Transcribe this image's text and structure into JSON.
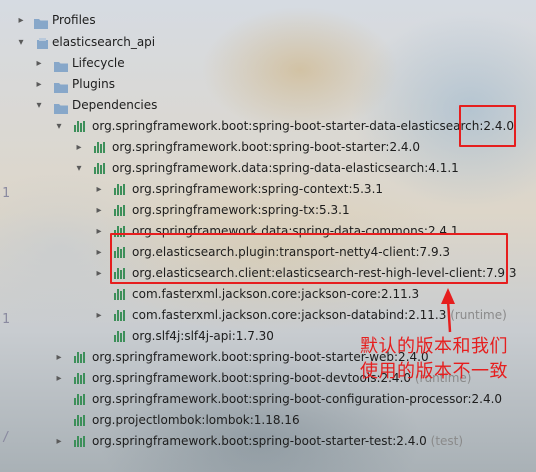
{
  "tree": {
    "profiles": "Profiles",
    "project": "elasticsearch_api",
    "lifecycle": "Lifecycle",
    "plugins": "Plugins",
    "dependencies": "Dependencies",
    "items": [
      {
        "text": "org.springframework.boot:spring-boot-starter-data-elasticsearch:2.4.0",
        "suffix": ""
      },
      {
        "text": "org.springframework.boot:spring-boot-starter:2.4.0",
        "suffix": ""
      },
      {
        "text": "org.springframework.data:spring-data-elasticsearch:4.1.1",
        "suffix": ""
      },
      {
        "text": "org.springframework:spring-context:5.3.1",
        "suffix": ""
      },
      {
        "text": "org.springframework:spring-tx:5.3.1",
        "suffix": ""
      },
      {
        "text": "org.springframework.data:spring-data-commons:2.4.1",
        "suffix": ""
      },
      {
        "text": "org.elasticsearch.plugin:transport-netty4-client:7.9.3",
        "suffix": ""
      },
      {
        "text": "org.elasticsearch.client:elasticsearch-rest-high-level-client:7.9.3",
        "suffix": ""
      },
      {
        "text": "com.fasterxml.jackson.core:jackson-core:2.11.3",
        "suffix": ""
      },
      {
        "text": "com.fasterxml.jackson.core:jackson-databind:2.11.3",
        "suffix": " (runtime)"
      },
      {
        "text": "org.slf4j:slf4j-api:1.7.30",
        "suffix": ""
      },
      {
        "text": "org.springframework.boot:spring-boot-starter-web:2.4.0",
        "suffix": ""
      },
      {
        "text": "org.springframework.boot:spring-boot-devtools:2.4.0",
        "suffix": " (runtime)"
      },
      {
        "text": "org.springframework.boot:spring-boot-configuration-processor:2.4.0",
        "suffix": ""
      },
      {
        "text": "org.projectlombok:lombok:1.18.16",
        "suffix": ""
      },
      {
        "text": "org.springframework.boot:spring-boot-starter-test:2.4.0",
        "suffix": " (test)"
      }
    ]
  },
  "gutter": [
    "1",
    "1",
    "/"
  ],
  "annotation": {
    "line1": "默认的版本和我们",
    "line2": "使用的版本不一致"
  },
  "colors": {
    "highlight": "#e61e1e",
    "library_icon": "#3d8f5a",
    "folder_icon": "#87a7c9"
  }
}
